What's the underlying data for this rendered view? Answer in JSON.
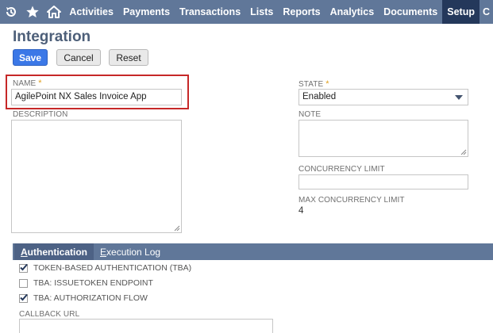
{
  "nav": {
    "icons": [
      "recent-icon",
      "star-icon",
      "home-icon"
    ],
    "items": [
      "Activities",
      "Payments",
      "Transactions",
      "Lists",
      "Reports",
      "Analytics",
      "Documents",
      "Setup",
      "C"
    ],
    "active": "Setup",
    "bar_color": "#607799",
    "active_color": "#24385b"
  },
  "page": {
    "title": "Integration"
  },
  "buttons": {
    "save": "Save",
    "cancel": "Cancel",
    "reset": "Reset",
    "save_color": "#3b78e7"
  },
  "form": {
    "name_label": "NAME",
    "name_value": "AgilePoint NX Sales Invoice App",
    "required_mark": "*",
    "description_label": "DESCRIPTION",
    "description_value": "",
    "state_label": "STATE",
    "state_value": "Enabled",
    "note_label": "NOTE",
    "note_value": "",
    "concurrency_label": "CONCURRENCY LIMIT",
    "concurrency_value": "",
    "max_concurrency_label": "MAX CONCURRENCY LIMIT",
    "max_concurrency_value": "4",
    "highlight_color": "#c62828"
  },
  "tabs": {
    "authentication": {
      "first": "A",
      "rest": "uthentication"
    },
    "execution_log": {
      "first": "E",
      "rest": "xecution Log"
    }
  },
  "auth": {
    "checkboxes": [
      {
        "label": "TOKEN-BASED AUTHENTICATION (TBA)",
        "checked": true
      },
      {
        "label": "TBA: ISSUETOKEN ENDPOINT",
        "checked": false
      },
      {
        "label": "TBA: AUTHORIZATION FLOW",
        "checked": true
      }
    ],
    "callback_label": "CALLBACK URL",
    "callback_value": ""
  }
}
